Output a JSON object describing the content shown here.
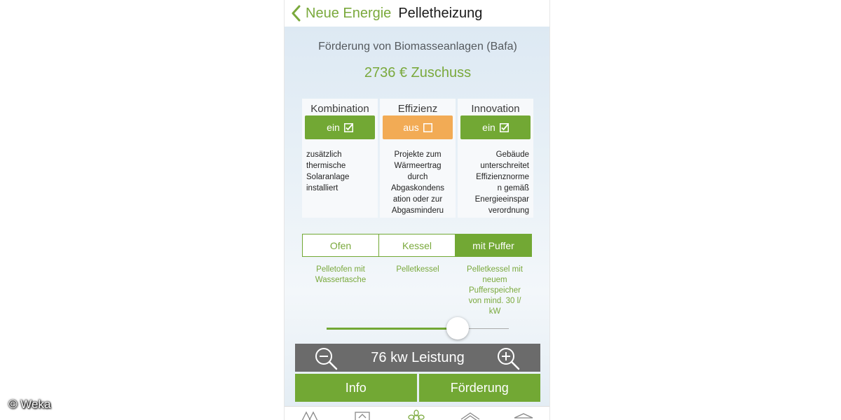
{
  "navbar": {
    "back_label": "Neue Energie",
    "title": "Pelletheizung"
  },
  "subsidy": {
    "title": "Förderung von Biomasseanlagen (Bafa)",
    "amount": "2736 € Zuschuss"
  },
  "options": [
    {
      "heading": "Kombination",
      "state": "on",
      "toggle_label": "ein",
      "desc_lines": [
        "zusätzlich",
        "thermische",
        "Solaranlage",
        "installiert"
      ]
    },
    {
      "heading": "Effizienz",
      "state": "off",
      "toggle_label": "aus",
      "desc_lines": [
        "Projekte zum",
        "Wärmeertrag",
        "durch",
        "Abgaskondens",
        "ation oder zur",
        "Abgasminderu"
      ]
    },
    {
      "heading": "Innovation",
      "state": "on",
      "toggle_label": "ein",
      "desc_lines": [
        "Gebäude",
        "unterschreitet",
        "Effizienznorme",
        "n gemäß",
        "Energieeinspar",
        "verordnung"
      ]
    }
  ],
  "heater_types": {
    "segments": [
      "Ofen",
      "Kessel",
      "mit Puffer"
    ],
    "selected": "mit Puffer",
    "descriptions": [
      [
        "Pelletofen mit",
        "Wassertasche"
      ],
      [
        "Pelletkessel"
      ],
      [
        "Pelletkessel mit",
        "neuem",
        "Pufferspeicher",
        "von mind. 30 l/",
        "kW"
      ]
    ]
  },
  "power": {
    "slider_fraction": 0.72,
    "label": "76 kw Leistung"
  },
  "actions": {
    "info_label": "Info",
    "foerderung_label": "Förderung"
  },
  "tabbar": {
    "icons": [
      "house-grid-icon",
      "solar-panel-icon",
      "flower-icon",
      "roof-icon",
      "cap-icon"
    ]
  },
  "watermark": "© Weka",
  "colors": {
    "accent_green": "#72a834",
    "text_green": "#7aa93c",
    "toggle_off": "#f2ab55",
    "power_bar": "#6b6b6b"
  }
}
